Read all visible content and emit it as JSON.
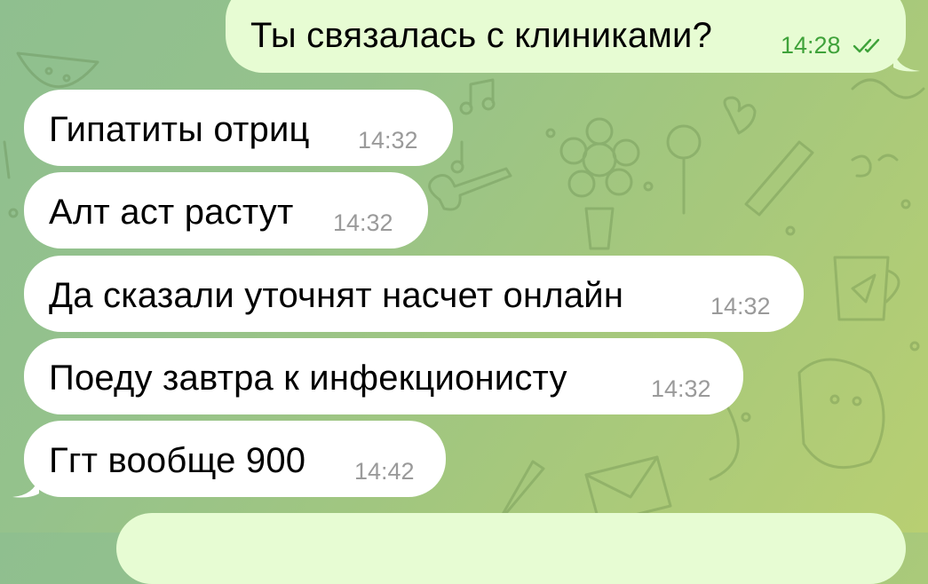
{
  "chat": {
    "messages": [
      {
        "direction": "outgoing",
        "text": "Ты связалась с клиниками?",
        "time": "14:28",
        "status": "read-double-check-icon"
      },
      {
        "direction": "incoming",
        "text": "Гипатиты отриц",
        "time": "14:32"
      },
      {
        "direction": "incoming",
        "text": "Алт аст растут",
        "time": "14:32"
      },
      {
        "direction": "incoming",
        "text": "Да сказали уточнят насчет онлайн",
        "time": "14:32"
      },
      {
        "direction": "incoming",
        "text": "Поеду завтра к инфекционисту",
        "time": "14:32"
      },
      {
        "direction": "incoming",
        "text": "Ггт вообще 900",
        "time": "14:42"
      }
    ]
  },
  "colors": {
    "outgoing_bubble": "#e7fcd3",
    "incoming_bubble": "#ffffff",
    "outgoing_time": "#3fa23a",
    "incoming_time": "#9a9a9a",
    "wallpaper_start": "#8fbf8f",
    "wallpaper_end": "#b8cf72"
  }
}
